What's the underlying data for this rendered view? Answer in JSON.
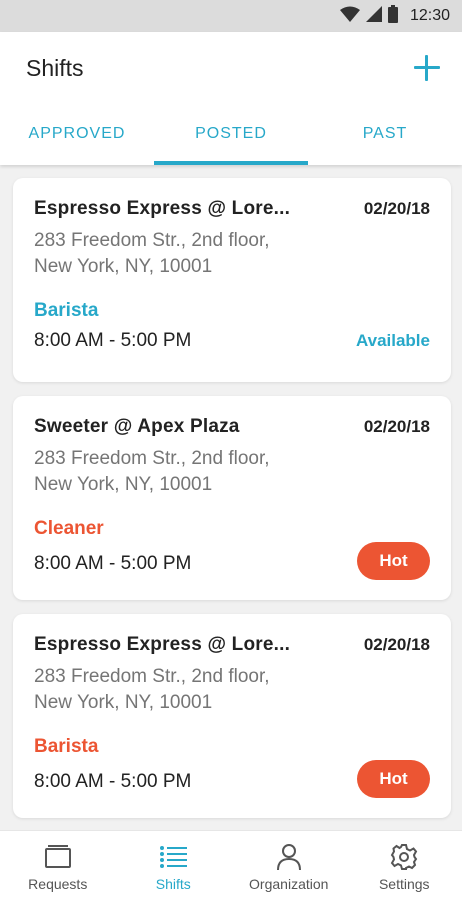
{
  "status_bar": {
    "time": "12:30"
  },
  "header": {
    "title": "Shifts"
  },
  "tabs": [
    {
      "label": "APPROVED",
      "active": false
    },
    {
      "label": "POSTED",
      "active": true
    },
    {
      "label": "PAST",
      "active": false
    }
  ],
  "shifts": [
    {
      "venue": "Espresso Express @ Lore...",
      "date": "02/20/18",
      "address_line1": "283 Freedom Str., 2nd floor,",
      "address_line2": "New York, NY, 10001",
      "role": "Barista",
      "role_color": "#27a8c9",
      "time": "8:00 AM - 5:00 PM",
      "status": "Available"
    },
    {
      "venue": "Sweeter @ Apex Plaza",
      "date": "02/20/18",
      "address_line1": "283 Freedom Str., 2nd floor,",
      "address_line2": "New York, NY, 10001",
      "role": "Cleaner",
      "role_color": "#ec5533",
      "time": "8:00 AM - 5:00 PM",
      "status": "Hot"
    },
    {
      "venue": "Espresso Express @ Lore...",
      "date": "02/20/18",
      "address_line1": "283 Freedom Str., 2nd floor,",
      "address_line2": "New York, NY, 10001",
      "role": "Barista",
      "role_color": "#ec5533",
      "time": "8:00 AM - 5:00 PM",
      "status": "Hot"
    }
  ],
  "bottom_nav": [
    {
      "label": "Requests",
      "icon": "requests-icon",
      "active": false
    },
    {
      "label": "Shifts",
      "icon": "list-icon",
      "active": true
    },
    {
      "label": "Organization",
      "icon": "person-icon",
      "active": false
    },
    {
      "label": "Settings",
      "icon": "gear-icon",
      "active": false
    }
  ],
  "colors": {
    "accent": "#27a8c9",
    "hot": "#ec5533"
  }
}
